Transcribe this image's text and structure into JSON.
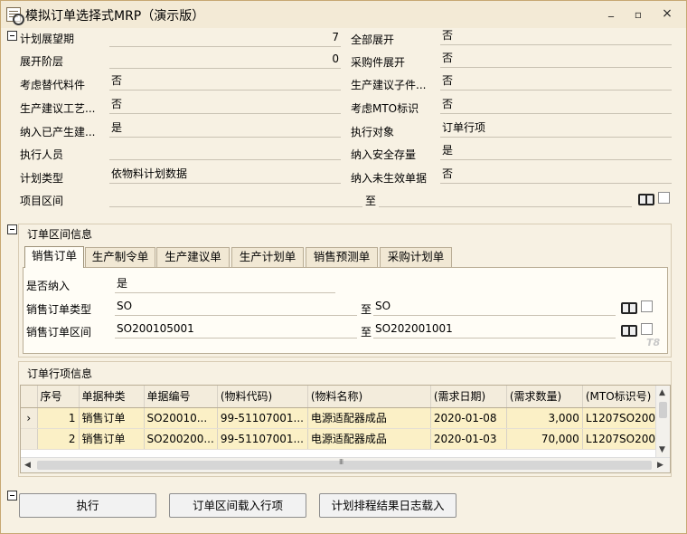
{
  "window": {
    "title": "模拟订单选择式MRP（演示版）",
    "minimize": "▫",
    "maximize": "▫",
    "close": "×"
  },
  "params": {
    "plan_period": {
      "label": "计划展望期",
      "value": "7"
    },
    "expand_all": {
      "label": "全部展开",
      "value": "否"
    },
    "expand_level": {
      "label": "展开阶层",
      "value": "0"
    },
    "purchase_expand": {
      "label": "采购件展开",
      "value": "否"
    },
    "consider_substitute": {
      "label": "考虑替代料件",
      "value": "否"
    },
    "production_suggest_sub": {
      "label": "生产建议子件...",
      "value": "否"
    },
    "production_suggest_process": {
      "label": "生产建议工艺...",
      "value": "否"
    },
    "consider_mto": {
      "label": "考虑MTO标识",
      "value": "否"
    },
    "include_produced": {
      "label": "纳入已产生建...",
      "value": "是"
    },
    "exec_object": {
      "label": "执行对象",
      "value": "订单行项"
    },
    "executor": {
      "label": "执行人员",
      "value": ""
    },
    "include_safety_stock": {
      "label": "纳入安全存量",
      "value": "是"
    },
    "plan_type": {
      "label": "计划类型",
      "value": "依物料计划数据"
    },
    "include_unapproved": {
      "label": "纳入未生效单据",
      "value": "否"
    },
    "project_range": {
      "label": "项目区间",
      "from": "",
      "to_label": "至",
      "to": ""
    }
  },
  "order_range": {
    "title": "订单区间信息",
    "tabs": [
      {
        "label": "销售订单",
        "active": true
      },
      {
        "label": "生产制令单",
        "active": false
      },
      {
        "label": "生产建议单",
        "active": false
      },
      {
        "label": "生产计划单",
        "active": false
      },
      {
        "label": "销售预测单",
        "active": false
      },
      {
        "label": "采购计划单",
        "active": false
      }
    ],
    "include": {
      "label": "是否纳入",
      "value": "是"
    },
    "order_type": {
      "label": "销售订单类型",
      "from": "SO",
      "to_label": "至",
      "to": "SO"
    },
    "order_range": {
      "label": "销售订单区间",
      "from": "SO200105001",
      "to_label": "至",
      "to": "SO202001001"
    },
    "watermark": "T8"
  },
  "lines": {
    "title": "订单行项信息",
    "columns": [
      "序号",
      "单据种类",
      "单据编号",
      "(物料代码)",
      "(物料名称)",
      "(需求日期)",
      "(需求数量)",
      "(MTO标识号)"
    ],
    "rows": [
      {
        "marker": "›",
        "cells": [
          "1",
          "销售订单",
          "SO20010...",
          "99-51107001...",
          "电源适配器成品",
          "2020-01-08",
          "3,000",
          "L1207SO200..."
        ]
      },
      {
        "marker": "",
        "cells": [
          "2",
          "销售订单",
          "SO200200...",
          "99-51107001...",
          "电源适配器成品",
          "2020-01-03",
          "70,000",
          "L1207SO200..."
        ]
      }
    ]
  },
  "scroll": {
    "up": "▲",
    "down": "▼",
    "left": "◀",
    "right": "▶"
  },
  "buttons": {
    "execute": "执行",
    "load_range": "订单区间载入行项",
    "load_log": "计划排程结果日志载入"
  }
}
